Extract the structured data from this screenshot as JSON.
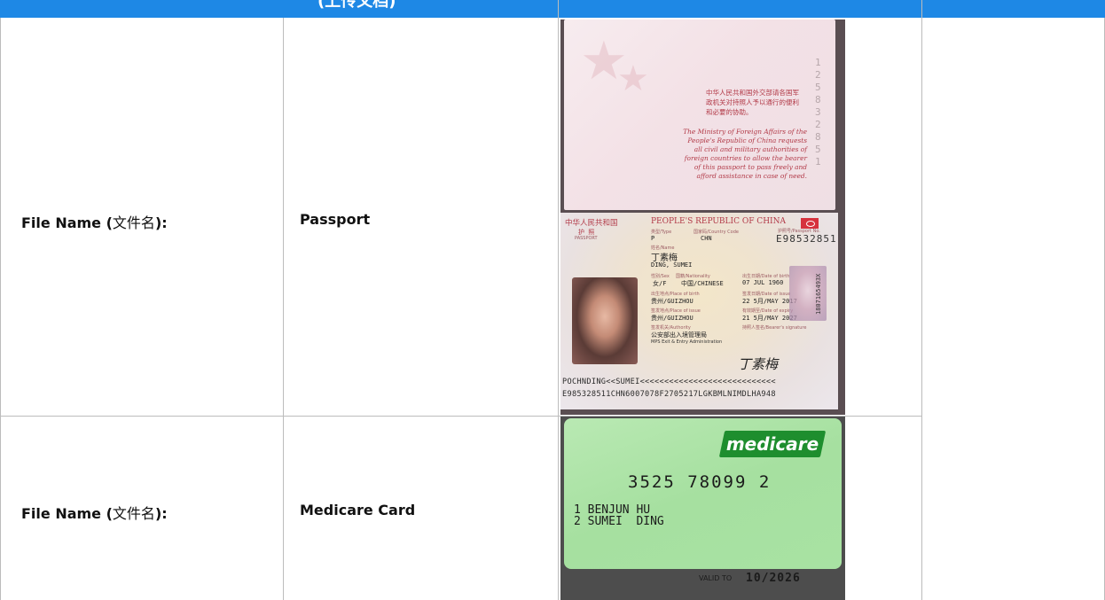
{
  "header": {
    "title": "(上传文档)",
    "color": "#1e88e5"
  },
  "rows": [
    {
      "label_en": "File Name (",
      "label_cn": "文件名",
      "label_close": "):",
      "value": "Passport"
    },
    {
      "label_en": "File Name (",
      "label_cn": "文件名",
      "label_close": "):",
      "value": "Medicare Card"
    }
  ],
  "passport": {
    "cn_note": "中华人民共和国外交部请各国军政机关对持照人予以通行的便利和必要的协助。",
    "en_note": "The Ministry of Foreign Affairs of the People's Republic of China requests all civil and military authorities of foreign countries to allow the bearer of this passport to pass freely and afford assistance in case of need.",
    "perforation": "1 2 5 8 3 2 8 5 1",
    "header_cn": "中华人民共和国",
    "header_en": "PEOPLE'S REPUBLIC OF CHINA",
    "doc_cn": "护  照",
    "doc_en": "PASSPORT",
    "type_label": "类型/Type",
    "type": "P",
    "country_label": "国家码/Country Code",
    "country": "CHN",
    "number_label": "护照号/Passport No.",
    "number": "E98532851",
    "name_label": "姓名/Name",
    "name_cn": "丁素梅",
    "name_en": "DING, SUMEI",
    "sex_label": "性别/Sex",
    "sex": "女/F",
    "nationality_label": "国籍/Nationality",
    "nationality": "中国/CHINESE",
    "dob_label": "出生日期/Date of birth",
    "dob": "07 JUL 1960",
    "pob_label": "出生地点/Place of birth",
    "pob": "贵州/GUIZHOU",
    "issue_date_label": "签发日期/Date of issue",
    "issue_date": "22 5月/MAY 2017",
    "poi_label": "签发地点/Place of issue",
    "poi": "贵州/GUIZHOU",
    "expiry_label": "有效期至/Date of expiry",
    "expiry": "21 5月/MAY 2027",
    "authority_label": "签发机关/Authority",
    "authority_cn": "公安部出入境管理局",
    "authority_en": "MPS Exit & Entry Administration",
    "signature_label": "持照人签名/Bearer's signature",
    "signature": "丁素梅",
    "side_no": "1807165493X",
    "mrz1": "POCHNDING<<SUMEI<<<<<<<<<<<<<<<<<<<<<<<<<<<<",
    "mrz2": "E985328511CHN6007078F2705217LGKBMLNIMDLHA948"
  },
  "medicare": {
    "logo": "medicare",
    "logo_color": "#1e8e2e",
    "number": "3525 78099 2",
    "line1": "1 BENJUN HU",
    "line2": "2 SUMEI  DING",
    "valid_label": "VALID TO",
    "valid_date": "10/2026"
  }
}
